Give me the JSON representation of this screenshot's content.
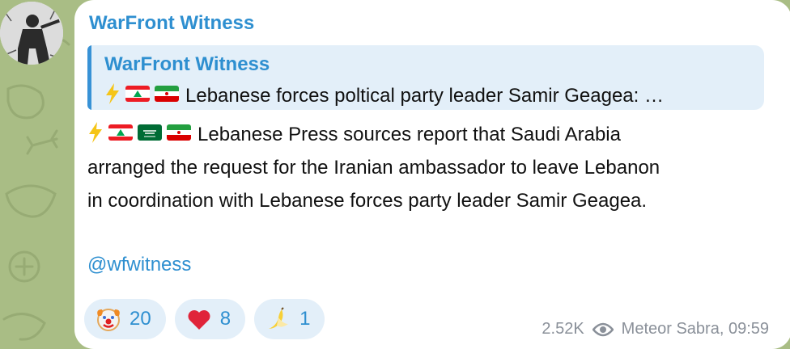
{
  "channel": {
    "name": "WarFront Witness",
    "avatar_icon": "soldier-avatar-icon"
  },
  "reply": {
    "author": "WarFront Witness",
    "text": "Lebanese forces poltical party leader Samir Geagea: …",
    "emojis": [
      "lightning-icon",
      "lebanon-flag-icon",
      "iran-flag-icon"
    ]
  },
  "message": {
    "emojis": [
      "lightning-icon",
      "lebanon-flag-icon",
      "saudi-flag-icon",
      "iran-flag-icon"
    ],
    "line1": "Lebanese Press sources report that Saudi Arabia",
    "line2": "arranged the request for the Iranian ambassador to leave Lebanon",
    "line3": "in coordination with Lebanese forces party leader Samir Geagea.",
    "link": "@wfwitness"
  },
  "reactions": [
    {
      "icon": "clown-face-icon",
      "count": "20"
    },
    {
      "icon": "red-heart-icon",
      "count": "8"
    },
    {
      "icon": "banana-icon",
      "count": "1"
    }
  ],
  "meta": {
    "views": "2.52K",
    "views_icon": "eye-icon",
    "signature": "Meteor Sabra, 09:59"
  },
  "colors": {
    "accent": "#2e8fd0",
    "reply_bg": "#e3eff9",
    "chat_bg": "#a9bd85",
    "meta_text": "#8a9099"
  }
}
